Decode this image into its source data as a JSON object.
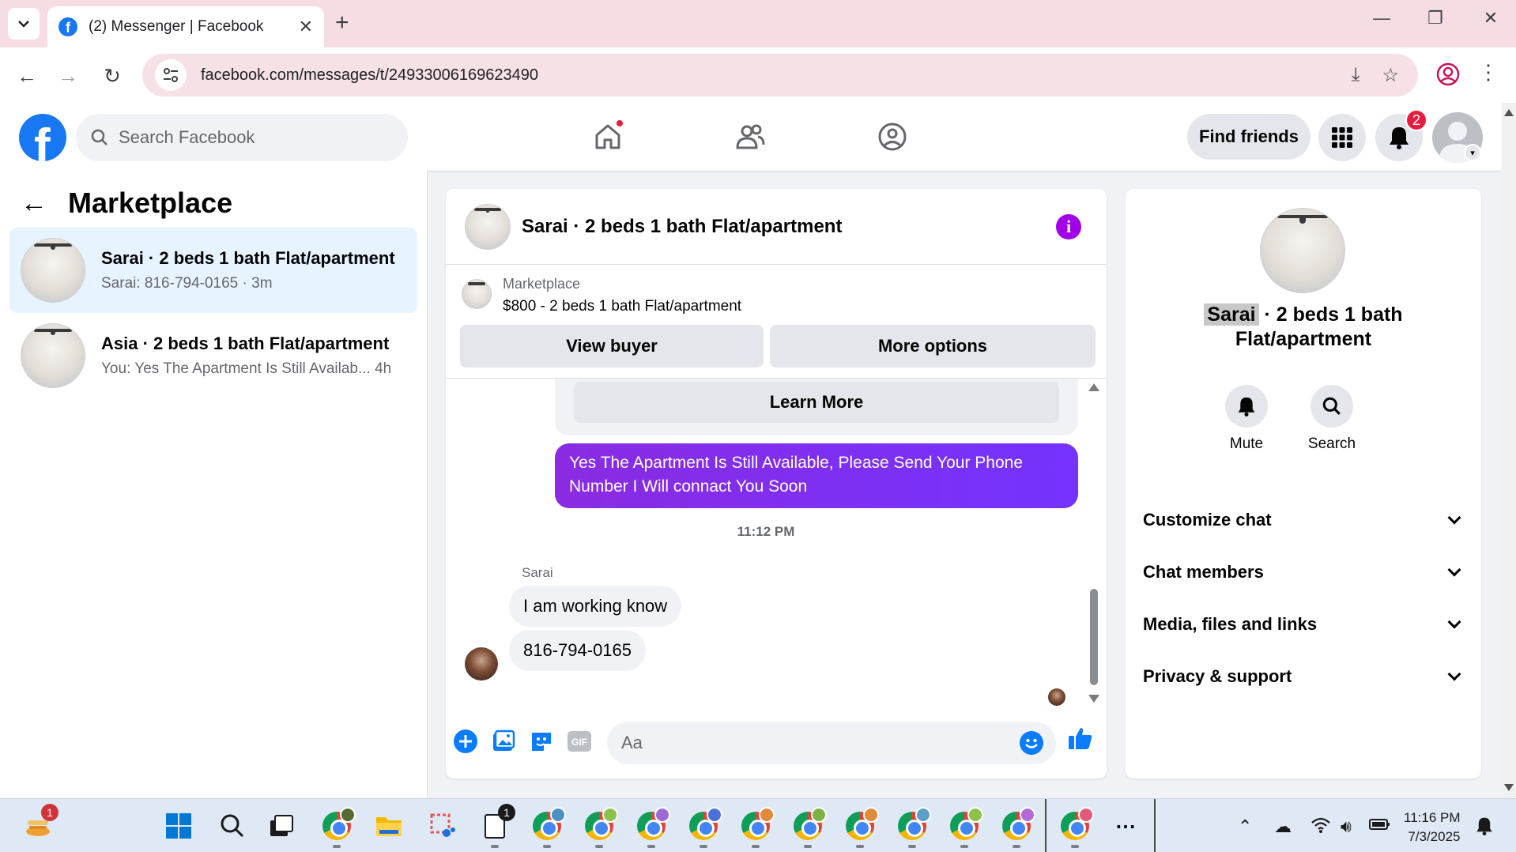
{
  "browser": {
    "tab_title": "(2) Messenger | Facebook",
    "url": "facebook.com/messages/t/24933006169623490",
    "window_controls": [
      "minimize-icon",
      "restore-icon",
      "close-icon"
    ]
  },
  "fb_header": {
    "search_placeholder": "Search Facebook",
    "find_friends_label": "Find friends",
    "notification_count": "2",
    "nav_icons": [
      "home-icon",
      "friends-icon",
      "groups-icon"
    ]
  },
  "left_panel": {
    "title": "Marketplace",
    "conversations": [
      {
        "name": "Sarai · 2 beds 1 bath Flat/apartment",
        "preview": "Sarai: 816-794-0165 · 3m",
        "active": true
      },
      {
        "name": "Asia · 2 beds 1 bath Flat/apartment",
        "preview": "You: Yes The Apartment Is Still Availab...  4h",
        "active": false
      }
    ]
  },
  "chat": {
    "title": "Sarai · 2 beds 1 bath Flat/apartment",
    "marketplace_label": "Marketplace",
    "listing": "$800 - 2 beds 1 bath Flat/apartment",
    "view_buyer_label": "View buyer",
    "more_options_label": "More options",
    "learn_more_label": "Learn More",
    "outgoing_message": "Yes The Apartment Is Still Available, Please Send Your Phone Number I Will connact You Soon",
    "timestamp": "11:12 PM",
    "sender_name": "Sarai",
    "incoming_messages": [
      "I am working know",
      "816-794-0165"
    ],
    "composer_placeholder": "Aa"
  },
  "right_panel": {
    "name_highlight": "Sarai",
    "name_rest_line1": "· 2 beds 1 bath",
    "name_line2": "Flat/apartment",
    "actions": [
      {
        "label": "Mute",
        "icon": "bell-icon"
      },
      {
        "label": "Search",
        "icon": "search-icon"
      }
    ],
    "sections": [
      "Customize chat",
      "Chat members",
      "Media, files and links",
      "Privacy & support"
    ]
  },
  "taskbar": {
    "time": "11:16 PM",
    "date": "7/3/2025",
    "widget_badge": "1",
    "notes_badge": "1"
  },
  "colors": {
    "facebook_blue": "#1877f2",
    "messenger_purple": "#7433ff",
    "notification_red": "#e41e3f"
  }
}
